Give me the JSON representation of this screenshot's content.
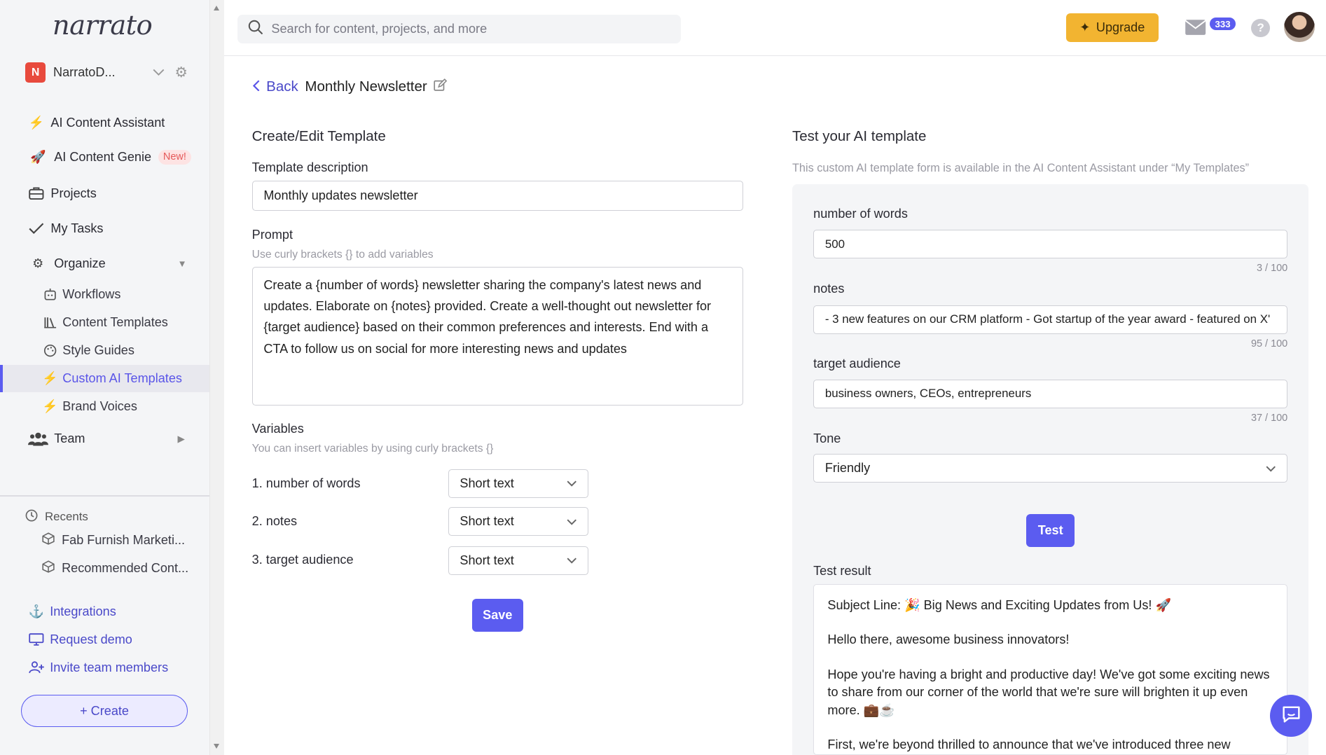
{
  "sidebar": {
    "logo": "narrato",
    "workspace": {
      "badge": "N",
      "name": "NarratoD..."
    },
    "nav": {
      "ai_assistant": "AI Content Assistant",
      "ai_genie": "AI Content Genie",
      "new_tag": "New!",
      "projects": "Projects",
      "my_tasks": "My Tasks",
      "organize": "Organize",
      "workflows": "Workflows",
      "content_templates": "Content Templates",
      "style_guides": "Style Guides",
      "custom_ai_templates": "Custom AI Templates",
      "brand_voices": "Brand Voices",
      "team": "Team"
    },
    "recents": {
      "heading": "Recents",
      "items": [
        "Fab Furnish Marketi...",
        "Recommended Cont..."
      ]
    },
    "links": {
      "integrations": "Integrations",
      "request_demo": "Request demo",
      "invite": "Invite team members"
    },
    "create_label": "+ Create"
  },
  "topbar": {
    "search_placeholder": "Search for content, projects, and more",
    "upgrade_label": "Upgrade",
    "mail_count": "333",
    "help": "?"
  },
  "header": {
    "back_label": "Back",
    "title": "Monthly Newsletter"
  },
  "editor": {
    "heading": "Create/Edit Template",
    "description_label": "Template description",
    "description_value": "Monthly updates newsletter",
    "prompt_label": "Prompt",
    "prompt_hint": "Use curly brackets {} to add variables",
    "prompt_value": "Create a {number of words} newsletter sharing the company's latest news and updates. Elaborate on {notes} provided. Create a well-thought out newsletter for {target audience} based on their common preferences and interests. End with a CTA to follow us on social for more interesting news and updates",
    "variables_label": "Variables",
    "variables_hint": "You can insert variables by using curly brackets {}",
    "variables": [
      {
        "name": "1. number of words",
        "type": "Short text"
      },
      {
        "name": "2. notes",
        "type": "Short text"
      },
      {
        "name": "3. target audience",
        "type": "Short text"
      }
    ],
    "save_label": "Save"
  },
  "tester": {
    "heading": "Test your AI template",
    "subtitle": "This custom AI template form is available in the AI Content Assistant under “My Templates”",
    "fields": [
      {
        "label": "number of words",
        "value": "500",
        "counter": "3 / 100"
      },
      {
        "label": "notes",
        "value": "- 3 new features on our CRM platform - Got startup of the year award - featured on X'",
        "counter": "95 / 100"
      },
      {
        "label": "target audience",
        "value": "business owners, CEOs, entrepreneurs",
        "counter": "37 / 100"
      }
    ],
    "tone_label": "Tone",
    "tone_value": "Friendly",
    "test_label": "Test",
    "result_label": "Test result",
    "result": [
      "Subject Line: 🎉 Big News and Exciting Updates from Us! 🚀",
      "Hello there, awesome business innovators!",
      "Hope you're having a bright and productive day! We've got some exciting news to share from our corner of the world that we're sure will brighten it up even more. 💼☕",
      "First, we're beyond thrilled to announce that we've introduced three new"
    ]
  },
  "colors": {
    "accent": "#5b5cf0",
    "upgrade": "#f2b431",
    "bolt": "#f3b12a"
  }
}
